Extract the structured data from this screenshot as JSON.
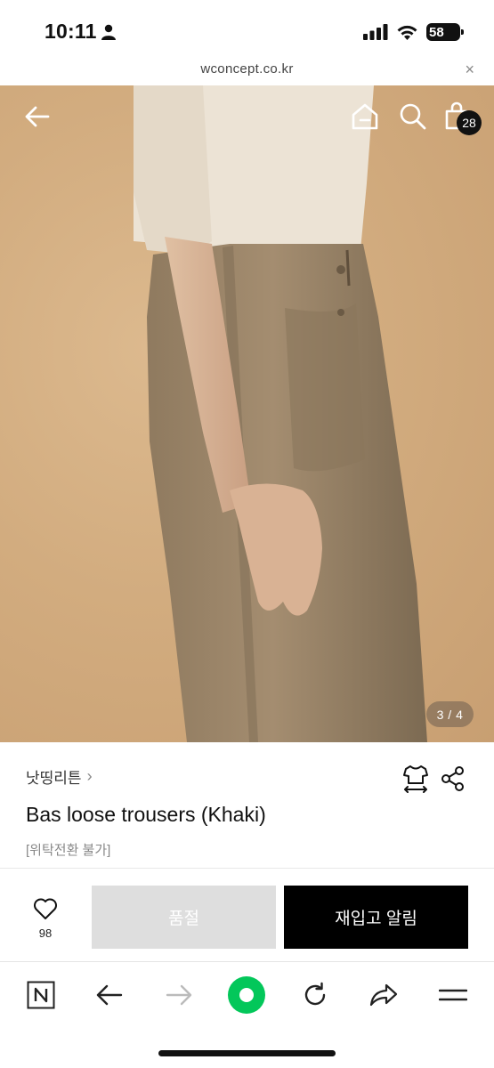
{
  "status_bar": {
    "time": "10:11",
    "battery": "58"
  },
  "url_bar": {
    "url": "wconcept.co.kr",
    "close_glyph": "×"
  },
  "hero": {
    "page_indicator": "3 / 4",
    "cart_count": "28"
  },
  "product": {
    "brand": "낫띵리튼",
    "brand_chevron": "›",
    "title": "Bas loose trousers (Khaki)",
    "note": "[위탁전환 불가]"
  },
  "actions": {
    "like_count": "98",
    "soldout_label": "품절",
    "restock_label": "재입고 알림"
  },
  "toolbar": {
    "items": [
      "naver-n-icon",
      "back-arrow-icon",
      "forward-arrow-icon",
      "green-circle-icon",
      "reload-icon",
      "share-arrow-icon",
      "menu-icon"
    ]
  },
  "colors": {
    "accent_green": "#03c75a",
    "hero_bg": "#d2ac7f",
    "restock_bg": "#000000",
    "soldout_bg": "#dedede"
  }
}
